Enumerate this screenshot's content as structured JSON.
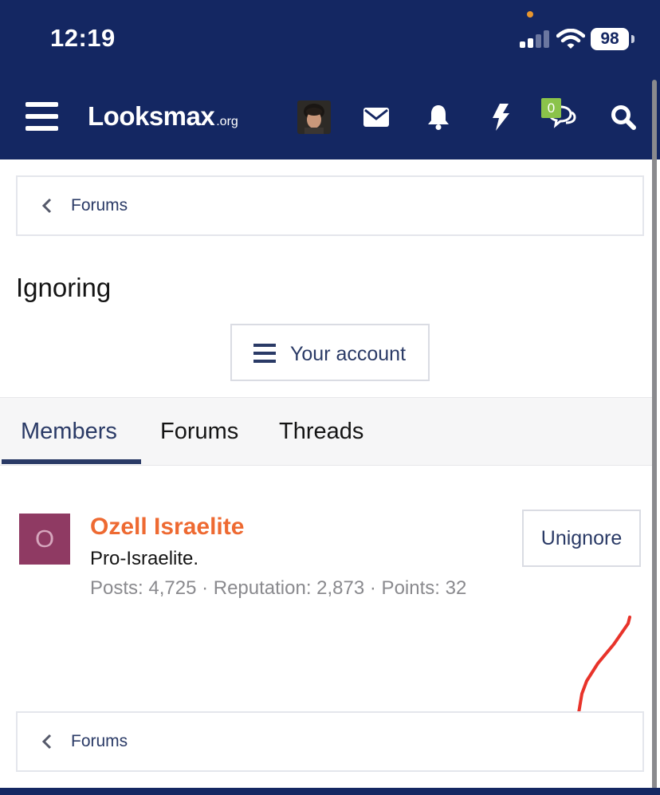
{
  "status_bar": {
    "time": "12:19",
    "battery": "98"
  },
  "header": {
    "logo_main": "Looksmax",
    "logo_tld": ".org",
    "chat_badge": "0",
    "colors": {
      "bar": "#142762",
      "badge": "#8bc34a"
    },
    "icons": [
      "menu-icon",
      "avatar",
      "envelope-icon",
      "bell-icon",
      "bolt-icon",
      "chat-icon",
      "search-icon"
    ]
  },
  "breadcrumb": {
    "top_label": "Forums",
    "bottom_label": "Forums"
  },
  "page": {
    "title": "Ignoring",
    "account_button": "Your account"
  },
  "tabs": [
    {
      "label": "Members",
      "active": true
    },
    {
      "label": "Forums",
      "active": false
    },
    {
      "label": "Threads",
      "active": false
    }
  ],
  "member": {
    "avatar_letter": "O",
    "name": "Ozell Israelite",
    "user_title": "Pro-Israelite.",
    "stats": "Posts: 4,725 · Reputation: 2,873 · Points: 32",
    "action": "Unignore",
    "colors": {
      "name": "#ee6a32",
      "avatar_bg": "#8f3a63"
    }
  }
}
